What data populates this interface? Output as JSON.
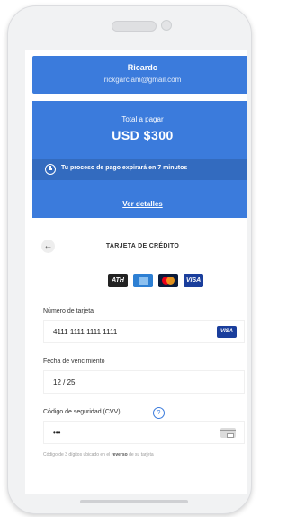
{
  "user": {
    "name": "Ricardo",
    "email": "rickgarciam@gmail.com"
  },
  "payment": {
    "total_label": "Total a pagar",
    "amount": "USD $300",
    "timer_text": "Tu proceso de pago expirará en 7 minutos",
    "details_link": "Ver detalles"
  },
  "card_form": {
    "back_icon": "arrow-left-icon",
    "title": "TARJETA DE CRÉDITO",
    "logos": {
      "ath": "ATH",
      "visa": "VISA"
    },
    "card_number_label": "Número de tarjeta",
    "card_number_value": "4111 1111 1111 1111",
    "detected_brand": "VISA",
    "expiry_label": "Fecha de vencimiento",
    "expiry_value": "12 / 25",
    "cvv_label": "Código de seguridad (CVV)",
    "cvv_help": "?",
    "cvv_value": "•••",
    "cvv_hint_before": "Código de 3 dígitos ubicado en el ",
    "cvv_hint_bold": "reverso",
    "cvv_hint_after": " de su tarjeta"
  },
  "colors": {
    "primary": "#3b7bdc",
    "primary_dark": "#336bbf",
    "visa_blue": "#1a3e9c"
  }
}
